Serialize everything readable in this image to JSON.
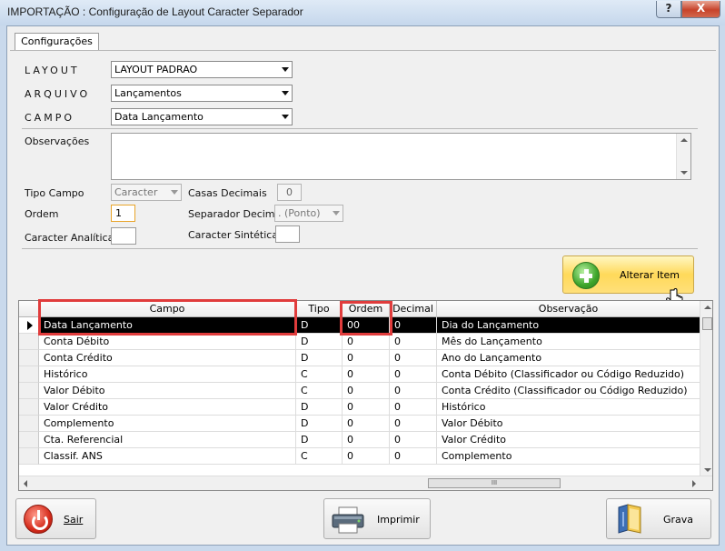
{
  "window": {
    "title": "IMPORTAÇÃO : Configuração de Layout Caracter Separador",
    "help_label": "?",
    "close_label": "X"
  },
  "tab": {
    "label": "Configurações"
  },
  "form": {
    "layout_label": "LAYOUT",
    "layout_value": "LAYOUT PADRAO",
    "arquivo_label": "ARQUIVO",
    "arquivo_value": "Lançamentos",
    "campo_label": "CAMPO",
    "campo_value": "Data Lançamento",
    "observacoes_label": "Observações",
    "tipo_campo_label": "Tipo Campo",
    "tipo_campo_value": "Caracter",
    "casas_decimais_label": "Casas Decimais",
    "casas_decimais_value": "0",
    "ordem_label": "Ordem",
    "ordem_value": "1",
    "separador_decimal_label": "Separador Decimal",
    "separador_decimal_value": ". (Ponto)",
    "caracter_analitica_label": "Caracter Analítica",
    "caracter_analitica_value": "",
    "caracter_sintetica_label": "Caracter Sintética",
    "caracter_sintetica_value": ""
  },
  "alterar_button": {
    "label": "Alterar Item"
  },
  "grid": {
    "columns": [
      "Campo",
      "Tipo",
      "Ordem",
      "Decimal",
      "Observação"
    ],
    "rows": [
      {
        "campo": "Data Lançamento",
        "tipo": "D",
        "ordem": "00",
        "decimal": "0",
        "observacao": "Dia do Lançamento"
      },
      {
        "campo": "Conta Débito",
        "tipo": "D",
        "ordem": "0",
        "decimal": "0",
        "observacao": "Mês do Lançamento"
      },
      {
        "campo": "Conta Crédito",
        "tipo": "D",
        "ordem": "0",
        "decimal": "0",
        "observacao": "Ano do Lançamento"
      },
      {
        "campo": "Histórico",
        "tipo": "C",
        "ordem": "0",
        "decimal": "0",
        "observacao": "Conta Débito (Classificador ou Código Reduzido)"
      },
      {
        "campo": "Valor Débito",
        "tipo": "C",
        "ordem": "0",
        "decimal": "0",
        "observacao": "Conta Crédito (Classificador ou Código Reduzido)"
      },
      {
        "campo": "Valor Crédito",
        "tipo": "D",
        "ordem": "0",
        "decimal": "0",
        "observacao": "Histórico"
      },
      {
        "campo": "Complemento",
        "tipo": "D",
        "ordem": "0",
        "decimal": "0",
        "observacao": "Valor Débito"
      },
      {
        "campo": "Cta. Referencial",
        "tipo": "D",
        "ordem": "0",
        "decimal": "0",
        "observacao": "Valor Crédito"
      },
      {
        "campo": "Classif. ANS",
        "tipo": "C",
        "ordem": "0",
        "decimal": "0",
        "observacao": "Complemento"
      }
    ],
    "scroll_thumb_label": "III"
  },
  "buttons": {
    "sair_label": "Sair",
    "imprimir_label": "Imprimir",
    "grava_label": "Grava"
  },
  "colors": {
    "highlight": "#e03c3c",
    "alterar_bg": "#ffd95a",
    "selected_row": "#000000"
  }
}
